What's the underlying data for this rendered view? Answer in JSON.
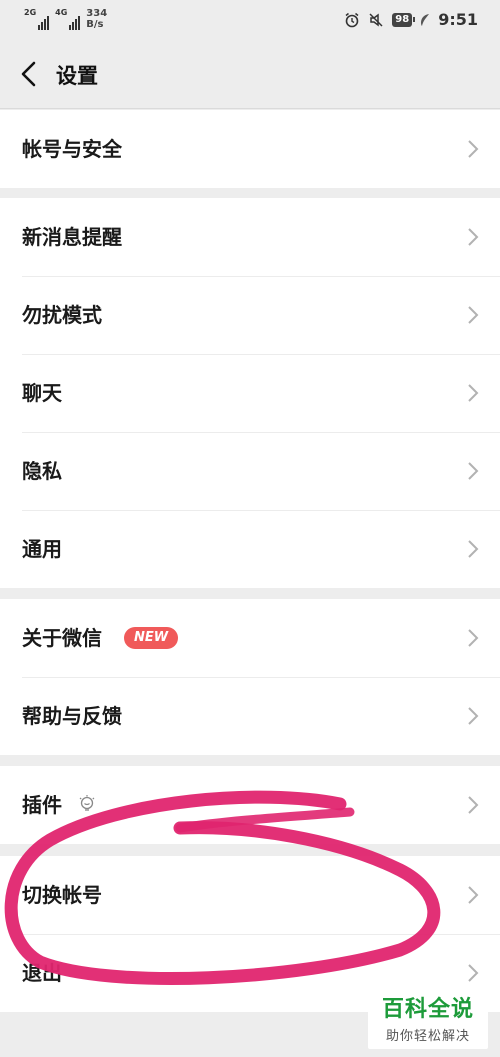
{
  "status_bar": {
    "net1": "2G",
    "net2": "4G",
    "speed_value": "334",
    "speed_unit": "B/s",
    "battery": "98",
    "time": "9:51"
  },
  "header": {
    "title": "设置"
  },
  "groups": [
    {
      "items": [
        {
          "label": "帐号与安全"
        }
      ]
    },
    {
      "items": [
        {
          "label": "新消息提醒"
        },
        {
          "label": "勿扰模式"
        },
        {
          "label": "聊天"
        },
        {
          "label": "隐私"
        },
        {
          "label": "通用"
        }
      ]
    },
    {
      "items": [
        {
          "label": "关于微信",
          "badge": "NEW"
        },
        {
          "label": "帮助与反馈"
        }
      ]
    },
    {
      "items": [
        {
          "label": "插件"
        }
      ]
    },
    {
      "items": [
        {
          "label": "切换帐号"
        },
        {
          "label": "退出"
        }
      ]
    }
  ],
  "annotation": {
    "color": "#e0256f"
  },
  "watermark": {
    "title": "百科全说",
    "subtitle": "助你轻松解决"
  },
  "colors": {
    "badge": "#f05a5a",
    "background": "#ededed",
    "watermark": "#1d9b3a"
  }
}
